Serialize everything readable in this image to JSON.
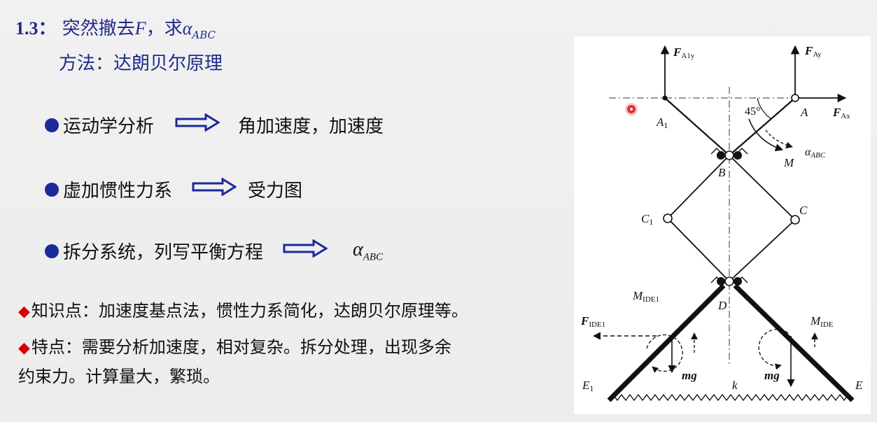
{
  "title": {
    "number": "1.3：",
    "text": "突然撤去",
    "force": "F",
    "comma_text": "，求",
    "alpha": "α",
    "alpha_sub": "ABC"
  },
  "method": "方法：达朗贝尔原理",
  "bullets": [
    {
      "label": "运动学分析",
      "result": "角加速度，加速度"
    },
    {
      "label": "虚加惯性力系",
      "result": "受力图"
    },
    {
      "label": "拆分系统，列写平衡方程",
      "result_alpha": "α",
      "result_sub": "ABC"
    }
  ],
  "knowledge": "知识点：加速度基点法，惯性力系简化，达朗贝尔原理等。",
  "features_line1": "特点：需要分析加速度，相对复杂。拆分处理，出现多余",
  "features_line2": "约束力。计算量大，繁琐。",
  "diagram": {
    "labels": {
      "FA1y": "F",
      "FA1y_sub": "A1y",
      "FAy": "F",
      "FAy_sub": "Ay",
      "FAx": "F",
      "FAx_sub": "Ax",
      "A1": "A",
      "A1_sub": "1",
      "A": "A",
      "angle": "45°",
      "alpha": "α",
      "alpha_sub": "ABC",
      "M": "M",
      "B": "B",
      "C1": "C",
      "C1_sub": "1",
      "C": "C",
      "D": "D",
      "MIDE1": "M",
      "MIDE1_sub": "IDE1",
      "MIDE": "M",
      "MIDE_sub": "IDE",
      "FIDE1": "F",
      "FIDE1_sub": "IDE1",
      "mg1": "mg",
      "mg2": "mg",
      "k": "k",
      "E1": "E",
      "E1_sub": "1",
      "E": "E"
    },
    "colors": {
      "line": "#111111",
      "accent_blue": "#1a2a9a",
      "diamond_red": "#d60000"
    }
  }
}
